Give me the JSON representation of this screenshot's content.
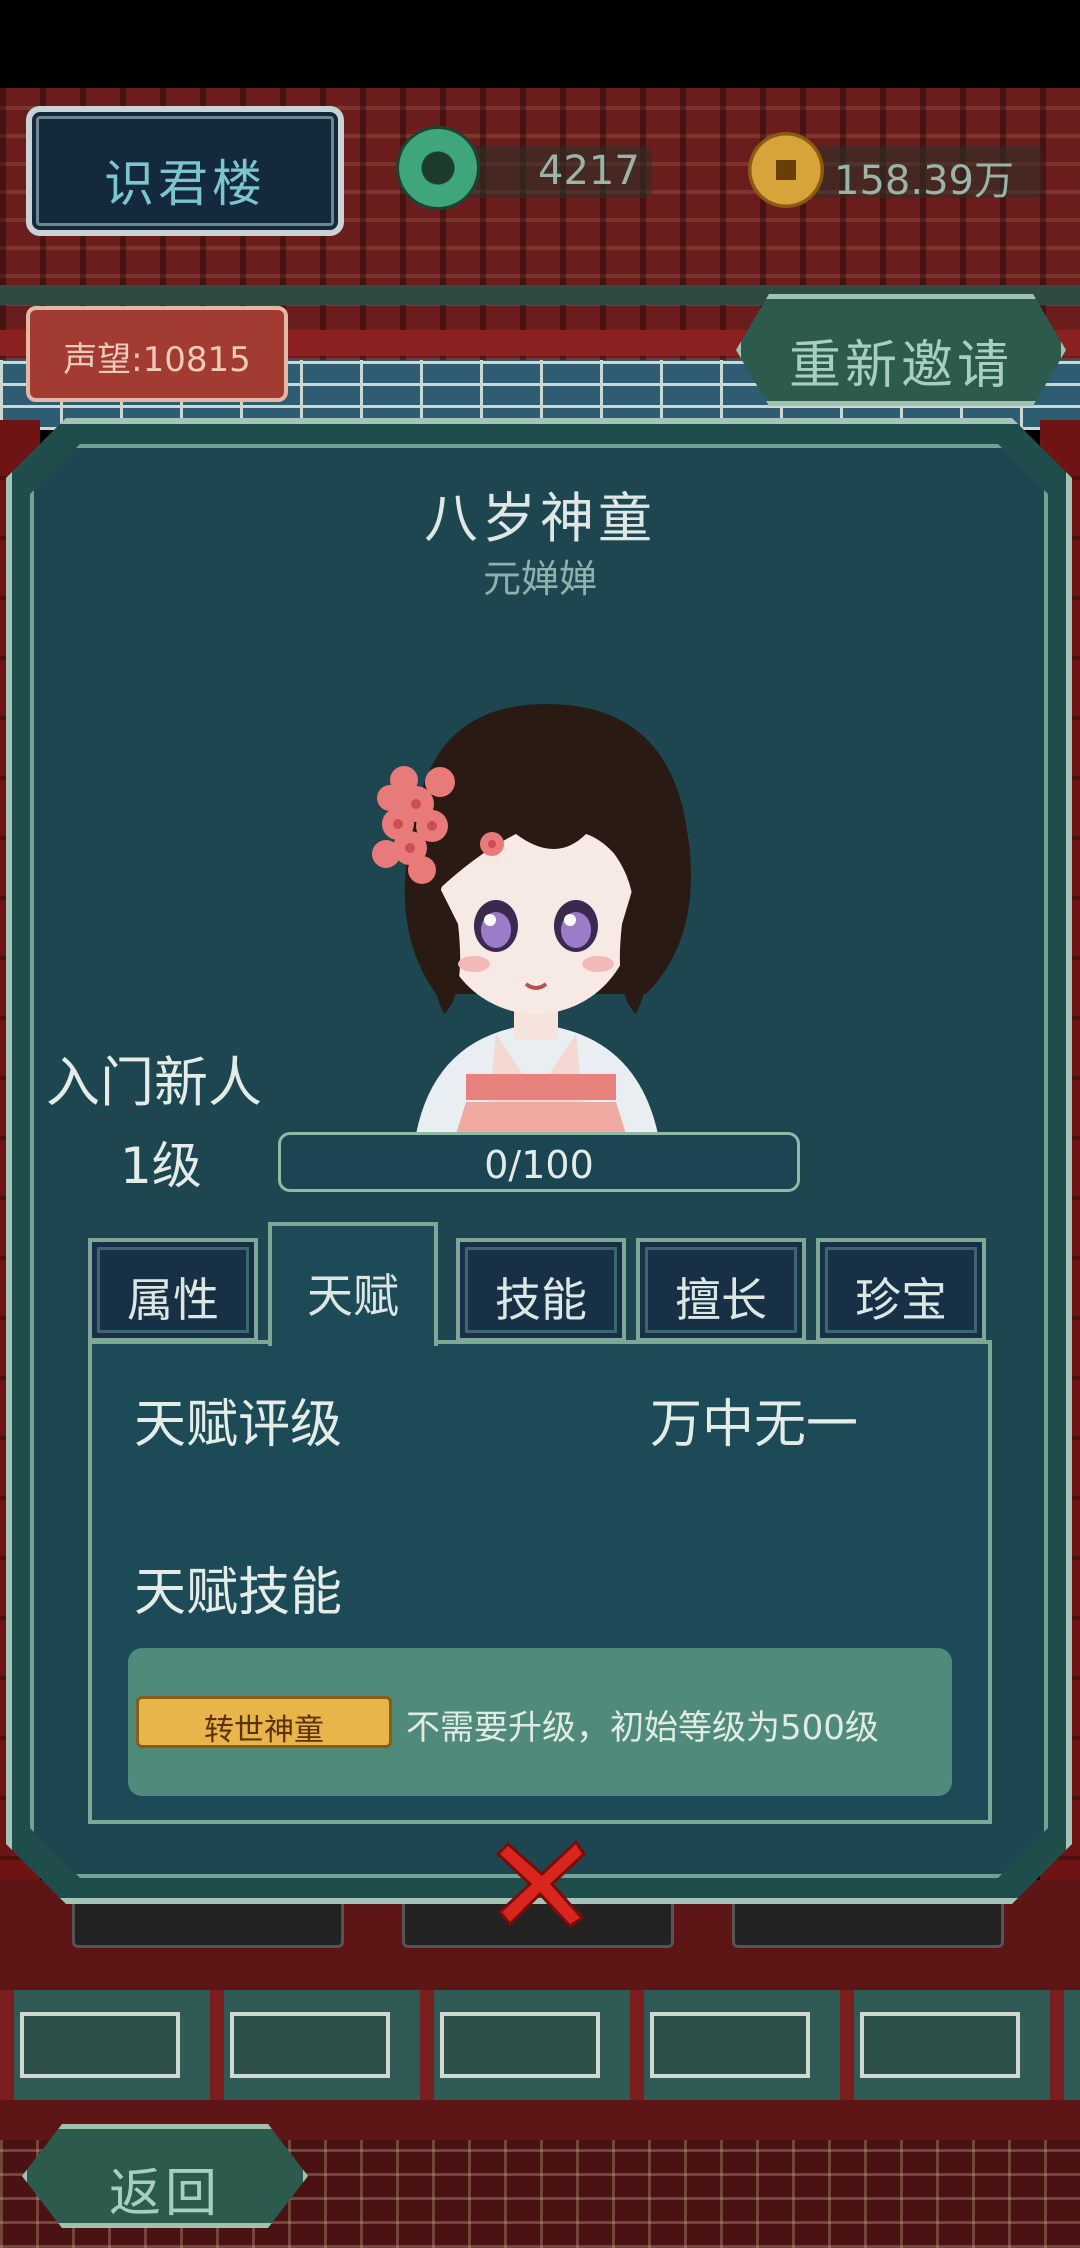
{
  "header": {
    "building_name": "识君楼",
    "jade_amount": "4217",
    "gold_amount": "158.39万",
    "reputation": "声望:10815",
    "reinvite_label": "重新邀请"
  },
  "character": {
    "title": "八岁神童",
    "name": "元婵婵",
    "rank": "入门新人",
    "level": "1级",
    "exp_text": "0/100",
    "exp_progress": 0
  },
  "tabs": [
    {
      "label": "属性",
      "active": false
    },
    {
      "label": "天赋",
      "active": true
    },
    {
      "label": "技能",
      "active": false
    },
    {
      "label": "擅长",
      "active": false
    },
    {
      "label": "珍宝",
      "active": false
    }
  ],
  "talent": {
    "rating_label": "天赋评级",
    "rating_value": "万中无一",
    "skill_label": "天赋技能",
    "skill_name": "转世神童",
    "skill_desc": "不需要升级，初始等级为500级"
  },
  "footer": {
    "back_label": "返回"
  },
  "icons": {
    "jade": "jade-coin-icon",
    "gold": "gold-coin-icon",
    "close": "close-icon"
  },
  "colors": {
    "panel_bg": "#1d4650",
    "accent_green": "#7da796",
    "close_red": "#d8261f",
    "skill_gold": "#e8b54a"
  }
}
